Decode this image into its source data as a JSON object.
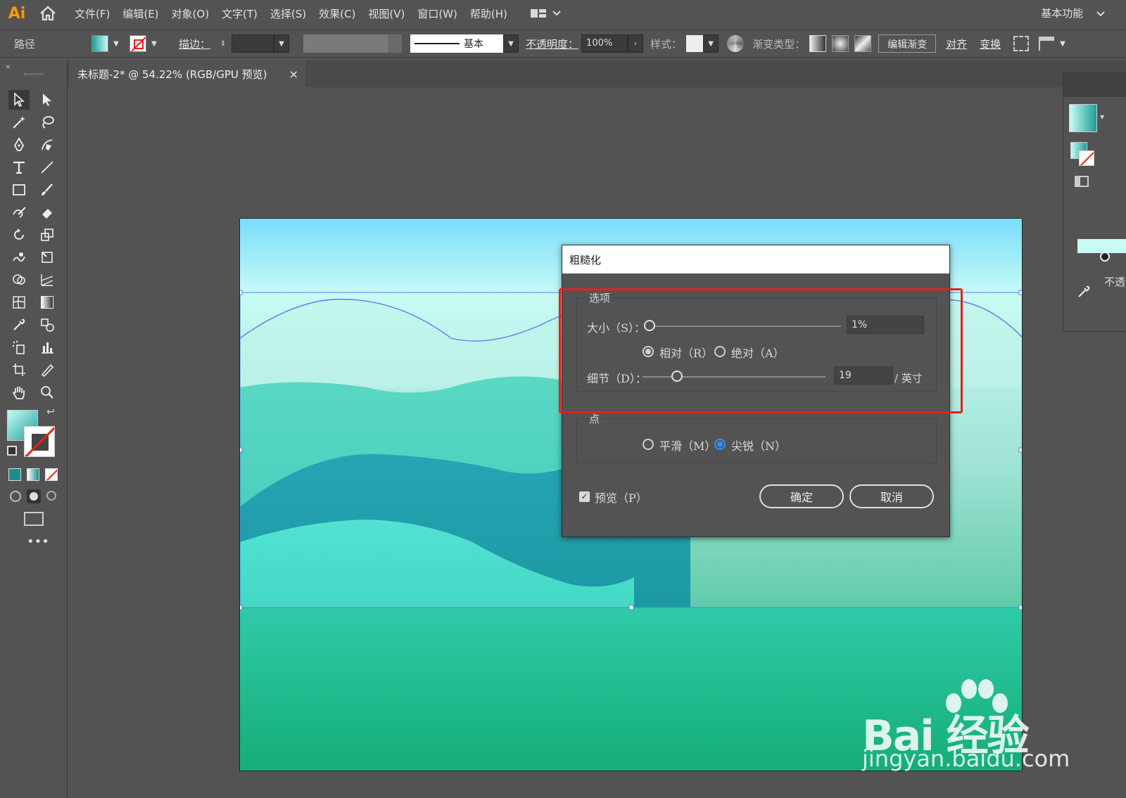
{
  "app": {
    "logo": "Ai",
    "menus": [
      "文件(F)",
      "编辑(E)",
      "对象(O)",
      "文字(T)",
      "选择(S)",
      "效果(C)",
      "视图(V)",
      "窗口(W)",
      "帮助(H)"
    ],
    "workspace": "基本功能"
  },
  "control_bar": {
    "object_type": "路径",
    "stroke_label": "描边：",
    "stroke_style": "基本",
    "opacity_label": "不透明度：",
    "opacity_value": "100%",
    "style_label": "样式：",
    "gradient_type_label": "渐变类型：",
    "edit_gradient": "编辑渐变",
    "align": "对齐",
    "transform": "变换"
  },
  "document_tab": {
    "title": "未标题-2* @ 54.22% (RGB/GPU 预览)",
    "close": "×"
  },
  "right_panel": {
    "opacity_label": "不透"
  },
  "dialog": {
    "title": "粗糙化",
    "options_group": "选项",
    "size_label": "大小（S）：",
    "size_value": "1%",
    "size_fraction": 0.0,
    "relative_label": "相对（R）",
    "absolute_label": "绝对（A）",
    "relative_selected": true,
    "detail_label": "细节（D）：",
    "detail_value": "19",
    "detail_unit": "/ 英寸",
    "detail_fraction": 0.19,
    "points_group": "点",
    "smooth_label": "平滑（M）",
    "corner_label": "尖锐（N）",
    "corner_selected": true,
    "preview_label": "预览（P）",
    "preview_checked": true,
    "ok": "确定",
    "cancel": "取消"
  },
  "watermark": {
    "brand": "Bai  经验",
    "url": "jingyan.baidu.com"
  },
  "colors": {
    "sky_top": "#7bdcfb",
    "sky_light": "#c8fbf5",
    "sea_bottom": "#16b07a",
    "wave_teal": "#1fa9b0",
    "wave_mint": "#43dcc8",
    "selection": "#4c86e8",
    "highlight": "#e8201a"
  }
}
